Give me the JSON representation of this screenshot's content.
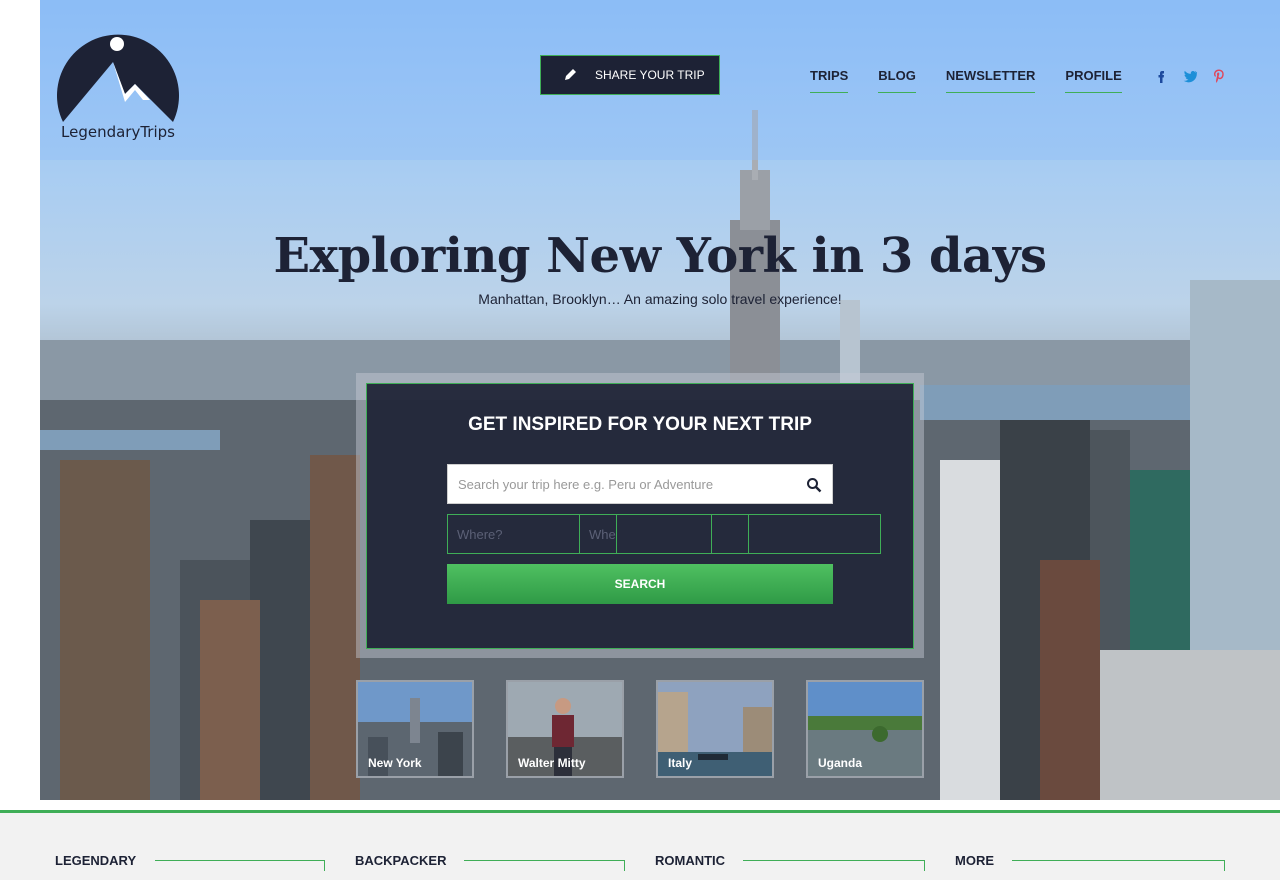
{
  "brand": {
    "logo_text": "LegendaryTrips"
  },
  "header": {
    "share_label": "SHARE YOUR TRIP",
    "nav": [
      "TRIPS",
      "BLOG",
      "NEWSLETTER",
      "PROFILE"
    ],
    "social_icons": [
      "facebook-icon",
      "twitter-icon",
      "pinterest-icon"
    ]
  },
  "hero": {
    "title": "Exploring New York in 3 days",
    "subtitle": "Manhattan, Brooklyn… An amazing solo travel experience!"
  },
  "search": {
    "heading": "GET INSPIRED FOR YOUR NEXT TRIP",
    "placeholder": "Search your trip here e.g. Peru or Adventure",
    "filters": [
      "Where?",
      "When",
      "",
      "",
      ""
    ],
    "button_label": "SEARCH"
  },
  "destinations": [
    "New York",
    "Walter Mitty",
    "Italy",
    "Uganda"
  ],
  "categories": [
    "LEGENDARY",
    "BACKPACKER",
    "ROMANTIC",
    "MORE"
  ],
  "colors": {
    "navy": "#1d2235",
    "green": "#3fae57",
    "sky": "#8cbdf5"
  }
}
